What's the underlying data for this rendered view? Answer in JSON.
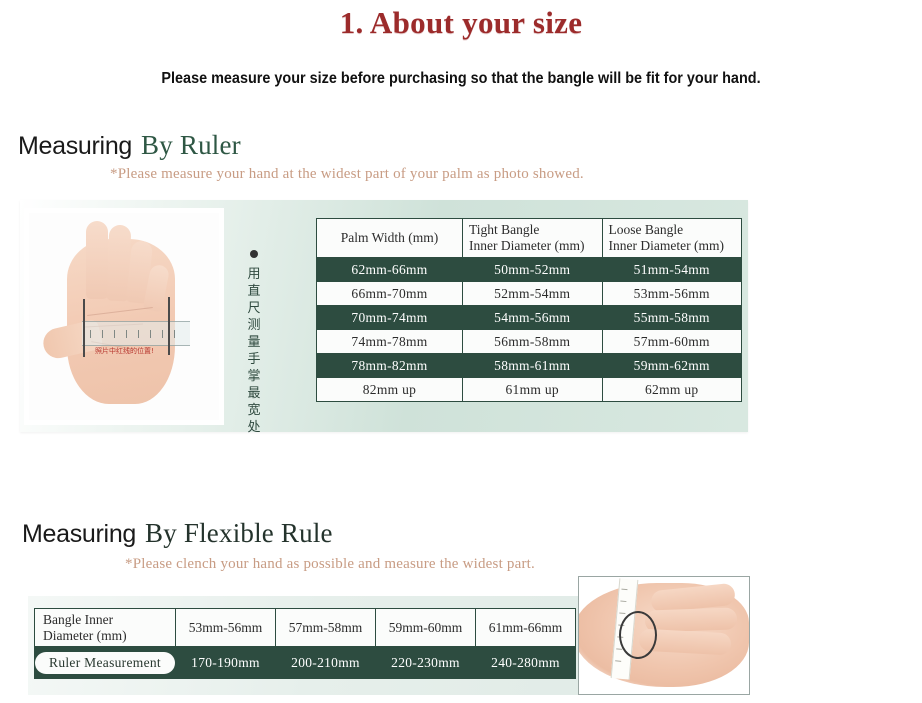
{
  "title": "1. About your size",
  "subtitle": "Please measure your size before purchasing so that the bangle will be fit for your hand.",
  "colors": {
    "title_red": "#9c2b2b",
    "table_green": "#2d4c40",
    "heading_green": "#2e5744",
    "note_tan": "#c89c84",
    "panel_mint": "#cfe2d9"
  },
  "section1": {
    "heading_first": "Measuring",
    "heading_rest": "By Ruler",
    "note": "*Please measure your hand at the widest part of your palm as photo showed.",
    "photo_alt": "palm-with-ruler-photo",
    "photo_caption_cn": "照片中红线的位置!",
    "vertical_note_cn": "用直尺测量手掌最宽处",
    "vertical_note_chars": [
      "用",
      "直",
      "尺",
      "测",
      "量",
      "手",
      "掌",
      "最",
      "宽",
      "处"
    ],
    "table": {
      "headers": [
        {
          "line1": "Palm Width (mm)",
          "line2": ""
        },
        {
          "line1": "Tight Bangle",
          "line2": "Inner Diameter (mm)"
        },
        {
          "line1": "Loose Bangle",
          "line2": "Inner Diameter (mm)"
        }
      ],
      "rows": [
        {
          "style": "dark",
          "cells": [
            "62mm-66mm",
            "50mm-52mm",
            "51mm-54mm"
          ]
        },
        {
          "style": "light",
          "cells": [
            "66mm-70mm",
            "52mm-54mm",
            "53mm-56mm"
          ]
        },
        {
          "style": "dark",
          "cells": [
            "70mm-74mm",
            "54mm-56mm",
            "55mm-58mm"
          ]
        },
        {
          "style": "light",
          "cells": [
            "74mm-78mm",
            "56mm-58mm",
            "57mm-60mm"
          ]
        },
        {
          "style": "dark",
          "cells": [
            "78mm-82mm",
            "58mm-61mm",
            "59mm-62mm"
          ]
        },
        {
          "style": "light",
          "cells": [
            "82mm up",
            "61mm up",
            "62mm up"
          ]
        }
      ]
    }
  },
  "section2": {
    "heading_first": "Measuring",
    "heading_rest": "By Flexible Rule",
    "note": "*Please clench your hand as possible and measure the widest part.",
    "photo_alt": "hand-with-measuring-tape-photo",
    "table": {
      "header_label_line1": "Bangle Inner",
      "header_label_line2": "Diameter (mm)",
      "header_values": [
        "53mm-56mm",
        "57mm-58mm",
        "59mm-60mm",
        "61mm-66mm"
      ],
      "row_label": "Ruler Measurement",
      "row_values": [
        "170-190mm",
        "200-210mm",
        "220-230mm",
        "240-280mm"
      ]
    }
  }
}
